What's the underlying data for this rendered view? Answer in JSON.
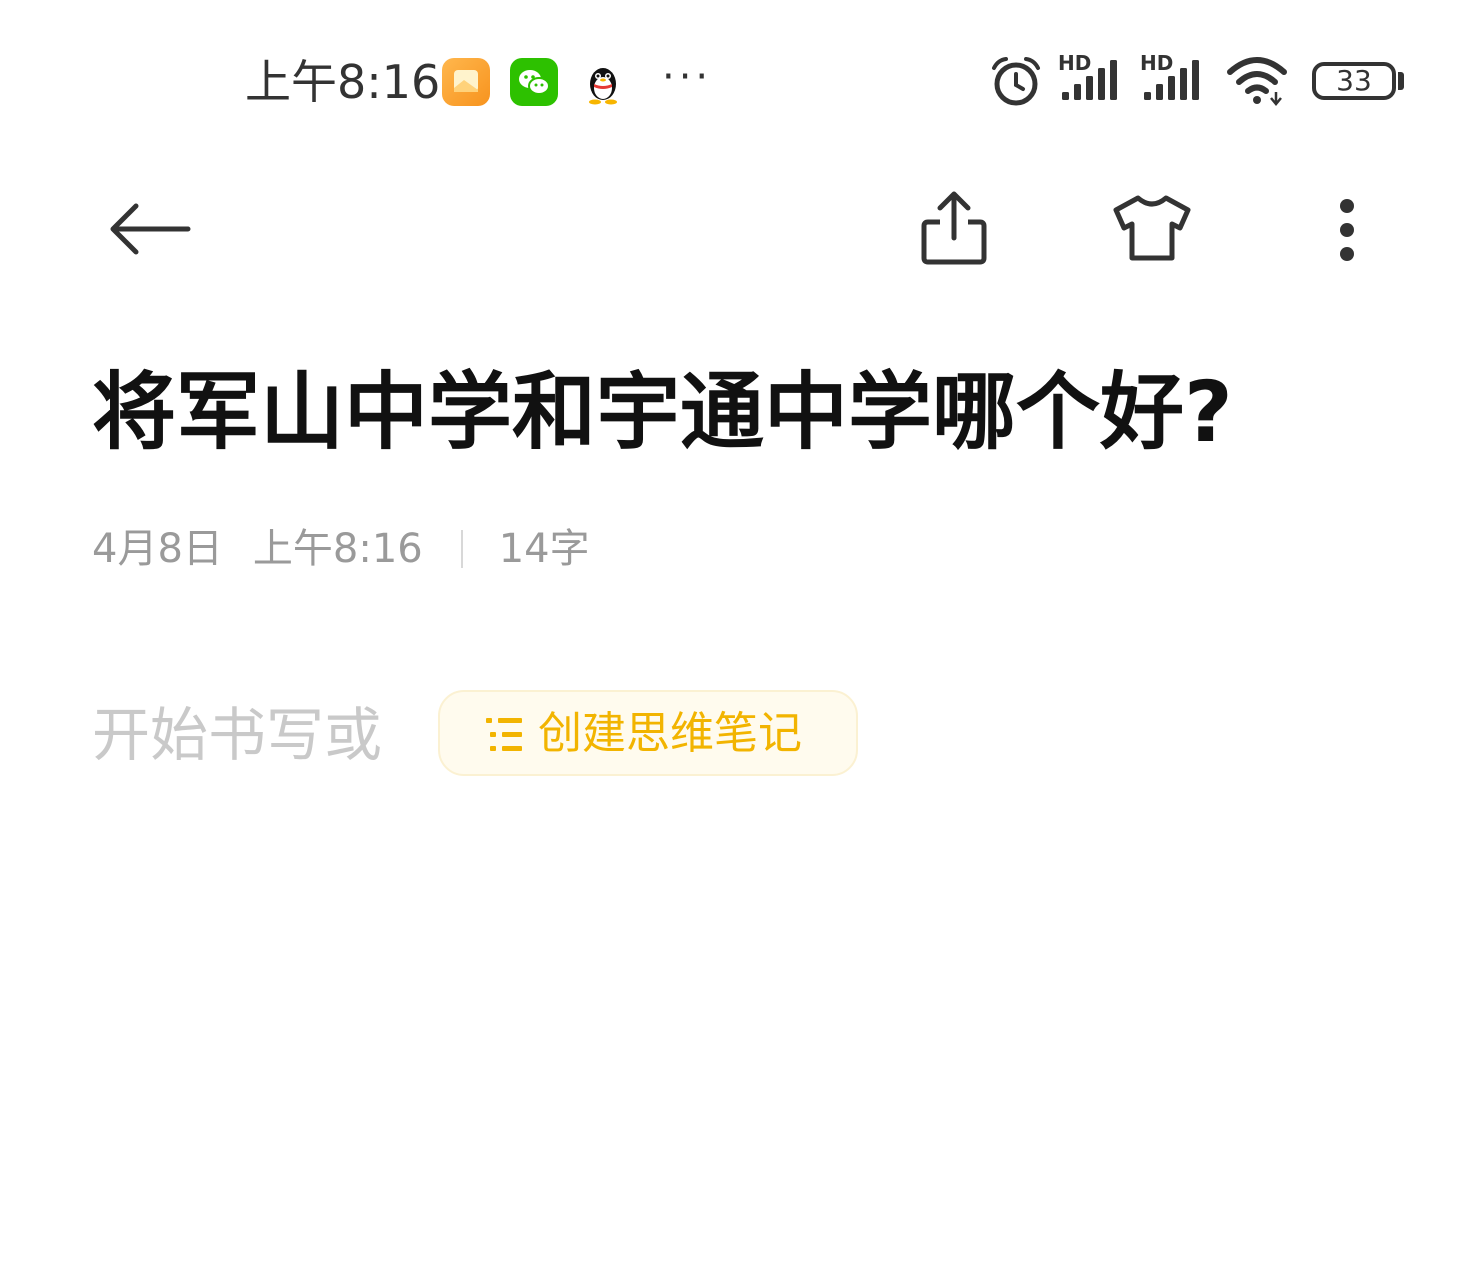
{
  "status_bar": {
    "time": "上午8:16",
    "notification_icons": [
      "gallery-icon",
      "wechat-icon",
      "qq-icon"
    ],
    "more_notifications": "···",
    "signal_1_label": "HD",
    "signal_2_label": "HD",
    "battery_level": "33"
  },
  "toolbar": {
    "back_icon": "arrow-left-icon",
    "share_icon": "share-icon",
    "theme_icon": "t-shirt-icon",
    "more_icon": "more-vertical-icon"
  },
  "note": {
    "title": "将军山中学和宇通中学哪个好?",
    "date": "4月8日",
    "time": "上午8:16",
    "word_count": "14字",
    "body_placeholder": "开始书写或",
    "mindmap_button_label": "创建思维笔记"
  },
  "colors": {
    "accent": "#f2b400",
    "accent_bg": "#fffbee",
    "title": "#111111",
    "meta": "#9a9a9a",
    "placeholder": "#c9c9c9"
  }
}
